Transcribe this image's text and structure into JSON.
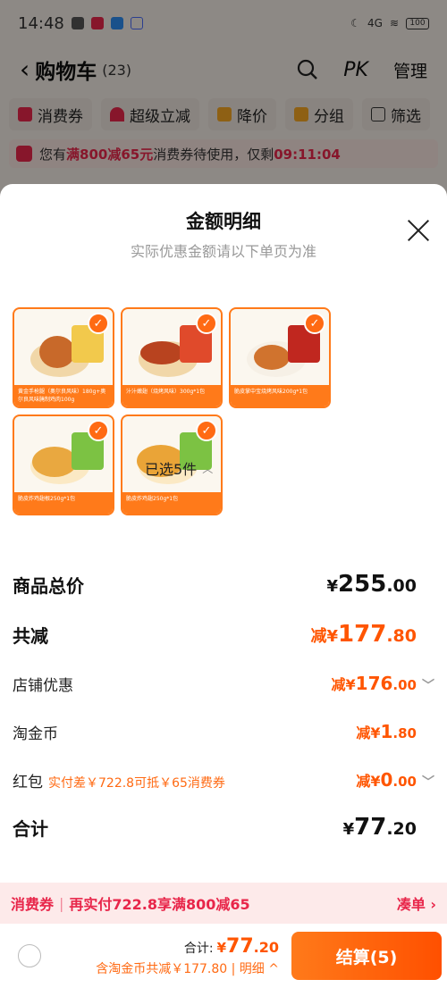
{
  "status_bar": {
    "time": "14:48",
    "network": "4G",
    "battery": "100"
  },
  "nav": {
    "title": "购物车",
    "count": "(23)",
    "pk": "PK",
    "manage": "管理"
  },
  "filters": [
    {
      "label": "消费券",
      "icon_color": "#e8264a"
    },
    {
      "label": "超级立减",
      "icon_color": "#e8264a"
    },
    {
      "label": "降价",
      "icon_color": "#f5a623"
    },
    {
      "label": "分组",
      "icon_color": "#f5a623"
    },
    {
      "label": "筛选",
      "icon_color": "#333333"
    }
  ],
  "banner": {
    "prefix": "您有",
    "highlight": "满800减65元",
    "middle": "消费券待使用，仅剩",
    "timer": "09:11:04"
  },
  "sheet": {
    "title": "金额明细",
    "subtitle": "实际优惠金额请以下单页为准",
    "selected_label": "已选5件",
    "products": [
      {
        "name": "黄金手枪腿（奥尔良风味）180g+奥尔良风味腌制鸡肉100g"
      },
      {
        "name": "汁汁嫩翅（烧烤风味）300g*1包"
      },
      {
        "name": "脆皮掌中宝烧烤风味200g*1包"
      },
      {
        "name": "脆皮炸鸡翅根250g*1包"
      },
      {
        "name": "脆皮炸鸡翅250g*1包"
      }
    ],
    "rows": {
      "total": {
        "label": "商品总价",
        "yuan": "¥",
        "int": "255",
        "dec": ".00"
      },
      "reduce": {
        "label": "共减",
        "prefix": "减",
        "yuan": "¥",
        "int": "177",
        "dec": ".80"
      },
      "shop": {
        "label": "店铺优惠",
        "prefix": "减",
        "yuan": "¥",
        "int": "176",
        "dec": ".00"
      },
      "coin": {
        "label": "淘金币",
        "prefix": "减",
        "yuan": "¥",
        "int": "1",
        "dec": ".80"
      },
      "redpack": {
        "label": "红包",
        "note": "实付差￥722.8可抵￥65消费券",
        "prefix": "减",
        "yuan": "¥",
        "int": "0",
        "dec": ".00"
      },
      "final": {
        "label": "合计",
        "yuan": "¥",
        "int": "77",
        "dec": ".20"
      }
    }
  },
  "promo": {
    "tag": "消费券",
    "text": "再实付722.8享满800减65",
    "link": "凑单 ›"
  },
  "bottom": {
    "total_label": "合计:",
    "total_yuan": "¥",
    "total_int": "77",
    "total_dec": ".20",
    "detail": "含淘金币共减￥177.80 | 明细 ^",
    "checkout": "结算(5)"
  },
  "colors": {
    "accent": "#ff5500",
    "promo_red": "#e8264a"
  }
}
